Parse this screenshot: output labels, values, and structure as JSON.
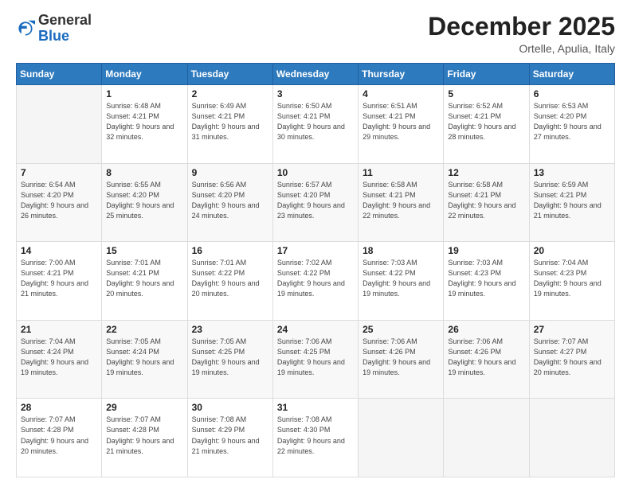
{
  "header": {
    "logo": {
      "general": "General",
      "blue": "Blue"
    },
    "month": "December 2025",
    "location": "Ortelle, Apulia, Italy"
  },
  "days_of_week": [
    "Sunday",
    "Monday",
    "Tuesday",
    "Wednesday",
    "Thursday",
    "Friday",
    "Saturday"
  ],
  "weeks": [
    [
      {
        "day": "",
        "info": ""
      },
      {
        "day": "1",
        "info": "Sunrise: 6:48 AM\nSunset: 4:21 PM\nDaylight: 9 hours\nand 32 minutes."
      },
      {
        "day": "2",
        "info": "Sunrise: 6:49 AM\nSunset: 4:21 PM\nDaylight: 9 hours\nand 31 minutes."
      },
      {
        "day": "3",
        "info": "Sunrise: 6:50 AM\nSunset: 4:21 PM\nDaylight: 9 hours\nand 30 minutes."
      },
      {
        "day": "4",
        "info": "Sunrise: 6:51 AM\nSunset: 4:21 PM\nDaylight: 9 hours\nand 29 minutes."
      },
      {
        "day": "5",
        "info": "Sunrise: 6:52 AM\nSunset: 4:21 PM\nDaylight: 9 hours\nand 28 minutes."
      },
      {
        "day": "6",
        "info": "Sunrise: 6:53 AM\nSunset: 4:20 PM\nDaylight: 9 hours\nand 27 minutes."
      }
    ],
    [
      {
        "day": "7",
        "info": "Sunrise: 6:54 AM\nSunset: 4:20 PM\nDaylight: 9 hours\nand 26 minutes."
      },
      {
        "day": "8",
        "info": "Sunrise: 6:55 AM\nSunset: 4:20 PM\nDaylight: 9 hours\nand 25 minutes."
      },
      {
        "day": "9",
        "info": "Sunrise: 6:56 AM\nSunset: 4:20 PM\nDaylight: 9 hours\nand 24 minutes."
      },
      {
        "day": "10",
        "info": "Sunrise: 6:57 AM\nSunset: 4:20 PM\nDaylight: 9 hours\nand 23 minutes."
      },
      {
        "day": "11",
        "info": "Sunrise: 6:58 AM\nSunset: 4:21 PM\nDaylight: 9 hours\nand 22 minutes."
      },
      {
        "day": "12",
        "info": "Sunrise: 6:58 AM\nSunset: 4:21 PM\nDaylight: 9 hours\nand 22 minutes."
      },
      {
        "day": "13",
        "info": "Sunrise: 6:59 AM\nSunset: 4:21 PM\nDaylight: 9 hours\nand 21 minutes."
      }
    ],
    [
      {
        "day": "14",
        "info": "Sunrise: 7:00 AM\nSunset: 4:21 PM\nDaylight: 9 hours\nand 21 minutes."
      },
      {
        "day": "15",
        "info": "Sunrise: 7:01 AM\nSunset: 4:21 PM\nDaylight: 9 hours\nand 20 minutes."
      },
      {
        "day": "16",
        "info": "Sunrise: 7:01 AM\nSunset: 4:22 PM\nDaylight: 9 hours\nand 20 minutes."
      },
      {
        "day": "17",
        "info": "Sunrise: 7:02 AM\nSunset: 4:22 PM\nDaylight: 9 hours\nand 19 minutes."
      },
      {
        "day": "18",
        "info": "Sunrise: 7:03 AM\nSunset: 4:22 PM\nDaylight: 9 hours\nand 19 minutes."
      },
      {
        "day": "19",
        "info": "Sunrise: 7:03 AM\nSunset: 4:23 PM\nDaylight: 9 hours\nand 19 minutes."
      },
      {
        "day": "20",
        "info": "Sunrise: 7:04 AM\nSunset: 4:23 PM\nDaylight: 9 hours\nand 19 minutes."
      }
    ],
    [
      {
        "day": "21",
        "info": "Sunrise: 7:04 AM\nSunset: 4:24 PM\nDaylight: 9 hours\nand 19 minutes."
      },
      {
        "day": "22",
        "info": "Sunrise: 7:05 AM\nSunset: 4:24 PM\nDaylight: 9 hours\nand 19 minutes."
      },
      {
        "day": "23",
        "info": "Sunrise: 7:05 AM\nSunset: 4:25 PM\nDaylight: 9 hours\nand 19 minutes."
      },
      {
        "day": "24",
        "info": "Sunrise: 7:06 AM\nSunset: 4:25 PM\nDaylight: 9 hours\nand 19 minutes."
      },
      {
        "day": "25",
        "info": "Sunrise: 7:06 AM\nSunset: 4:26 PM\nDaylight: 9 hours\nand 19 minutes."
      },
      {
        "day": "26",
        "info": "Sunrise: 7:06 AM\nSunset: 4:26 PM\nDaylight: 9 hours\nand 19 minutes."
      },
      {
        "day": "27",
        "info": "Sunrise: 7:07 AM\nSunset: 4:27 PM\nDaylight: 9 hours\nand 20 minutes."
      }
    ],
    [
      {
        "day": "28",
        "info": "Sunrise: 7:07 AM\nSunset: 4:28 PM\nDaylight: 9 hours\nand 20 minutes."
      },
      {
        "day": "29",
        "info": "Sunrise: 7:07 AM\nSunset: 4:28 PM\nDaylight: 9 hours\nand 21 minutes."
      },
      {
        "day": "30",
        "info": "Sunrise: 7:08 AM\nSunset: 4:29 PM\nDaylight: 9 hours\nand 21 minutes."
      },
      {
        "day": "31",
        "info": "Sunrise: 7:08 AM\nSunset: 4:30 PM\nDaylight: 9 hours\nand 22 minutes."
      },
      {
        "day": "",
        "info": ""
      },
      {
        "day": "",
        "info": ""
      },
      {
        "day": "",
        "info": ""
      }
    ]
  ]
}
